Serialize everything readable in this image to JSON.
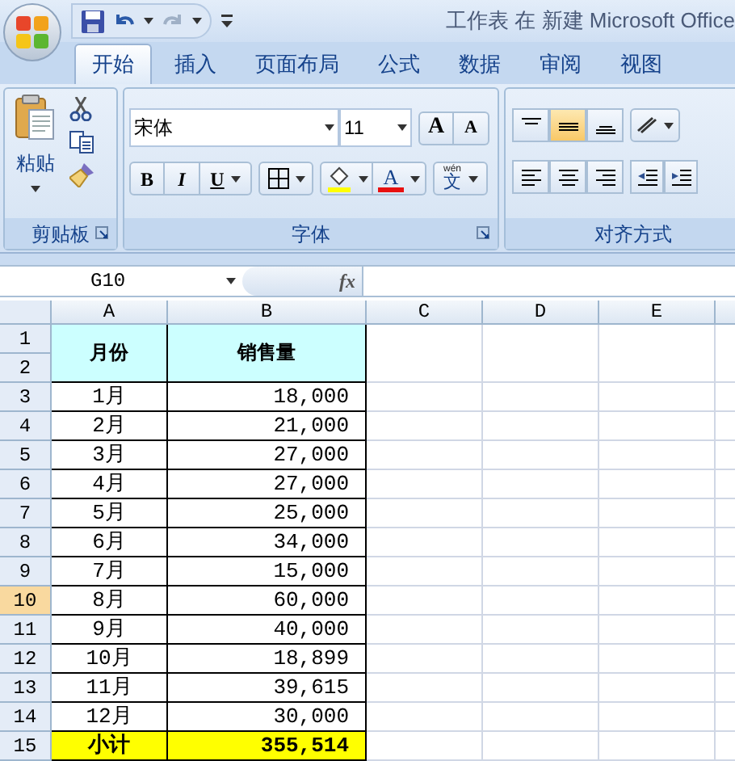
{
  "window": {
    "title": "工作表 在 新建 Microsoft Office"
  },
  "tabs": [
    {
      "label": "开始",
      "selected": true
    },
    {
      "label": "插入",
      "selected": false
    },
    {
      "label": "页面布局",
      "selected": false
    },
    {
      "label": "公式",
      "selected": false
    },
    {
      "label": "数据",
      "selected": false
    },
    {
      "label": "审阅",
      "selected": false
    },
    {
      "label": "视图",
      "selected": false
    }
  ],
  "ribbon": {
    "clipboard": {
      "paste_label": "粘贴",
      "group_label": "剪贴板"
    },
    "font": {
      "font_name": "宋体",
      "font_size": "11",
      "grow_label": "A",
      "shrink_label": "A",
      "bold_label": "B",
      "italic_label": "I",
      "underline_label": "U",
      "font_color_label": "A",
      "phonetic_top": "wén",
      "phonetic_bottom": "文",
      "group_label": "字体"
    },
    "alignment": {
      "group_label": "对齐方式"
    }
  },
  "formula_bar": {
    "name_box": "G10",
    "fx_label": "fx"
  },
  "columns": [
    {
      "label": "A",
      "selected": false
    },
    {
      "label": "B",
      "selected": false
    },
    {
      "label": "C",
      "selected": false
    },
    {
      "label": "D",
      "selected": false
    },
    {
      "label": "E",
      "selected": false
    }
  ],
  "rows": [
    {
      "label": "1",
      "selected": false
    },
    {
      "label": "2",
      "selected": false
    },
    {
      "label": "3",
      "selected": false
    },
    {
      "label": "4",
      "selected": false
    },
    {
      "label": "5",
      "selected": false
    },
    {
      "label": "6",
      "selected": false
    },
    {
      "label": "7",
      "selected": false
    },
    {
      "label": "8",
      "selected": false
    },
    {
      "label": "9",
      "selected": false
    },
    {
      "label": "10",
      "selected": true
    },
    {
      "label": "11",
      "selected": false
    },
    {
      "label": "12",
      "selected": false
    },
    {
      "label": "13",
      "selected": false
    },
    {
      "label": "14",
      "selected": false
    },
    {
      "label": "15",
      "selected": false
    }
  ],
  "table": {
    "header": [
      "月份",
      "销售量"
    ],
    "data": [
      [
        "1月",
        "18,000"
      ],
      [
        "2月",
        "21,000"
      ],
      [
        "3月",
        "27,000"
      ],
      [
        "4月",
        "27,000"
      ],
      [
        "5月",
        "25,000"
      ],
      [
        "6月",
        "34,000"
      ],
      [
        "7月",
        "15,000"
      ],
      [
        "8月",
        "60,000"
      ],
      [
        "9月",
        "40,000"
      ],
      [
        "10月",
        "18,899"
      ],
      [
        "11月",
        "39,615"
      ],
      [
        "12月",
        "30,000"
      ]
    ],
    "total": [
      "小计",
      "355,514"
    ]
  }
}
